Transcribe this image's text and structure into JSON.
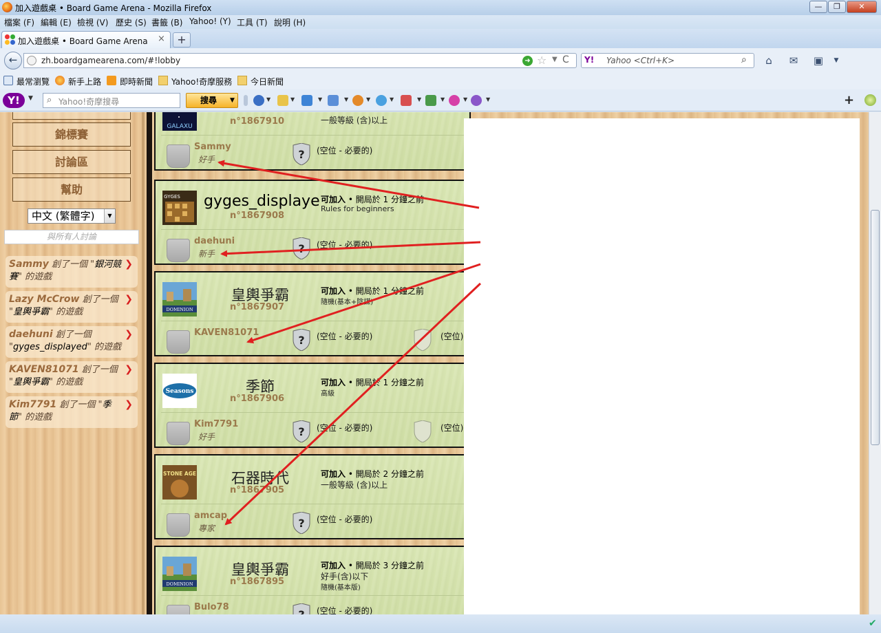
{
  "window": {
    "title": "加入遊戲桌 • Board Game Arena - Mozilla Firefox",
    "min": "—",
    "max": "❐",
    "close": "✕"
  },
  "menu": [
    "檔案 (F)",
    "編輯 (E)",
    "檢視 (V)",
    "歷史 (S)",
    "書籤 (B)",
    "Yahoo! (Y)",
    "工具 (T)",
    "說明 (H)"
  ],
  "tab": {
    "label": "加入遊戲桌 • Board Game Arena",
    "close": "×",
    "new": "+"
  },
  "nav": {
    "url": "zh.boardgamearena.com/#!lobby",
    "search_placeholder": "Yahoo <Ctrl+K>",
    "search_engine": "Y!",
    "back": "←",
    "star": "☆",
    "reload": "C"
  },
  "bookmarks": [
    "最常瀏覽",
    "新手上路",
    "即時新聞",
    "Yahoo!奇摩服務",
    "今日新聞"
  ],
  "yahoo_toolbar": {
    "logo": "Y!",
    "search_placeholder": "Yahoo!奇摩搜尋",
    "search_button": "搜尋",
    "plus": "+"
  },
  "sidebar": {
    "buttons": [
      "錦標賽",
      "討論區",
      "幫助"
    ],
    "language": "中文 (繁體字)",
    "chat_placeholder": "與所有人討論",
    "news": [
      {
        "who": "Sammy",
        "pre": " 創了一個 \"",
        "game": "銀河競賽",
        "post": "\" 的遊戲"
      },
      {
        "who": "Lazy McCrow",
        "pre": " 創了一個 \"",
        "game": "皇輿爭霸",
        "post": "\" 的遊戲"
      },
      {
        "who": "daehuni",
        "pre": " 創了一個 \"",
        "game": "gyges_displayed",
        "post": "\" 的遊戲"
      },
      {
        "who": "KAVEN81071",
        "pre": " 創了一個 \"",
        "game": "皇輿爭霸",
        "post": "\" 的遊戲"
      },
      {
        "who": "Kim7791",
        "pre": " 創了一個 \"",
        "game": "季節",
        "post": "\" 的遊戲"
      }
    ]
  },
  "tables": [
    {
      "game": "",
      "thumb": "GALAXU",
      "table_id": "n°1867910",
      "join": "",
      "started": "",
      "options": [
        "一般等級 (含)以上"
      ],
      "player": "Sammy",
      "level": "好手",
      "seat_text": "(空位 - 必要的)",
      "seat2_text": ""
    },
    {
      "game": "gyges_displaye",
      "thumb": "GYGES",
      "table_id": "n°1867908",
      "join": "可加入",
      "started": "開局於 1 分鐘之前",
      "options": [
        "Rules for beginners"
      ],
      "player": "daehuni",
      "level": "新手",
      "seat_text": "(空位 - 必要的)",
      "seat2_text": ""
    },
    {
      "game": "皇輿爭霸",
      "thumb": "DOMINION",
      "table_id": "n°1867907",
      "join": "可加入",
      "started": "開局於 1 分鐘之前",
      "options": [
        "隨機(基本+陰謀)"
      ],
      "player": "KAVEN81071",
      "level": "",
      "seat_text": "(空位 - 必要的)",
      "seat2_text": "(空位)"
    },
    {
      "game": "季節",
      "thumb": "Seasons",
      "table_id": "n°1867906",
      "join": "可加入",
      "started": "開局於 1 分鐘之前",
      "options": [
        "高級"
      ],
      "player": "Kim7791",
      "level": "好手",
      "seat_text": "(空位 - 必要的)",
      "seat2_text": "(空位)"
    },
    {
      "game": "石器時代",
      "thumb": "STONE AGE",
      "table_id": "n°1867905",
      "join": "可加入",
      "started": "開局於 2 分鐘之前",
      "options": [
        "一般等級 (含)以上"
      ],
      "player": "amcap",
      "level": "專家",
      "seat_text": "(空位 - 必要的)",
      "seat2_text": ""
    },
    {
      "game": "皇輿爭霸",
      "thumb": "DOMINION",
      "table_id": "n°1867895",
      "join": "可加入",
      "started": "開局於 3 分鐘之前",
      "options": [
        "好手(含)以下",
        "隨機(基本版)"
      ],
      "player": "Bulo78",
      "level": "",
      "seat_text": "(空位 - 必要的)",
      "seat2_text": ""
    }
  ],
  "colors": {
    "arrow": "#e02020",
    "card_bg": "#d5e3ad",
    "player_name": "#9b7a4c",
    "wood": "#e7c394"
  }
}
